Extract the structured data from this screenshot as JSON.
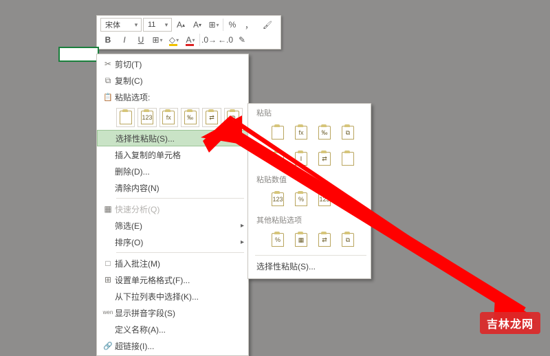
{
  "toolbar": {
    "font_name": "宋体",
    "font_size": "11",
    "percent": "%",
    "thousands": "，"
  },
  "menu": {
    "cut": "剪切(T)",
    "copy": "复制(C)",
    "paste_options_label": "粘贴选项:",
    "paste_opts_glyphs": [
      "",
      "123",
      "fx",
      "‰",
      "⇄",
      "⧉"
    ],
    "paste_special": "选择性粘贴(S)...",
    "insert_copied": "插入复制的单元格",
    "delete": "删除(D)...",
    "clear": "清除内容(N)",
    "quick_analysis": "快速分析(Q)",
    "filter": "筛选(E)",
    "sort": "排序(O)",
    "insert_comment": "插入批注(M)",
    "format_cells": "设置单元格格式(F)...",
    "pick_from_list": "从下拉列表中选择(K)...",
    "show_pinyin": "显示拼音字段(S)",
    "define_name": "定义名称(A)...",
    "hyperlink": "超链接(I)..."
  },
  "submenu": {
    "heading_paste": "粘贴",
    "row1": [
      "",
      "fx",
      "‰",
      "⧉"
    ],
    "row2": [
      "",
      "ⵏ",
      "⇄",
      ""
    ],
    "heading_values": "粘贴数值",
    "row3": [
      "123",
      "%",
      "123",
      ""
    ],
    "heading_other": "其他粘贴选项",
    "row4": [
      "%",
      "▦",
      "⇄",
      "⧉"
    ],
    "paste_special": "选择性粘贴(S)..."
  },
  "watermark": "吉林龙网"
}
